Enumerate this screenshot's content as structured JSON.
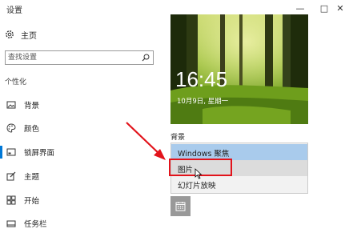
{
  "window": {
    "title": "设置",
    "minimize_glyph": "—",
    "maximize_glyph": "□",
    "close_glyph": "✕"
  },
  "sidebar": {
    "home_label": "主页",
    "search_placeholder": "查找设置",
    "section_title": "个性化",
    "items": [
      {
        "label": "背景",
        "icon": "picture-icon",
        "active": false
      },
      {
        "label": "颜色",
        "icon": "palette-icon",
        "active": false
      },
      {
        "label": "锁屏界面",
        "icon": "lock-screen-icon",
        "active": true
      },
      {
        "label": "主题",
        "icon": "theme-brush-icon",
        "active": false
      },
      {
        "label": "开始",
        "icon": "start-grid-icon",
        "active": false
      },
      {
        "label": "任务栏",
        "icon": "taskbar-icon",
        "active": false
      }
    ]
  },
  "lockscreen_preview": {
    "time": "16:45",
    "date": "10月9日, 星期一"
  },
  "background": {
    "label": "背景",
    "options": [
      "Windows 聚焦",
      "图片",
      "幻灯片放映"
    ],
    "selected_index": 0,
    "hovered_index": 1
  },
  "colors": {
    "accent": "#0078d7",
    "selected_option": "#a9cbec",
    "hover_option": "#dcdcdc",
    "annotation_red": "#e2131b"
  }
}
